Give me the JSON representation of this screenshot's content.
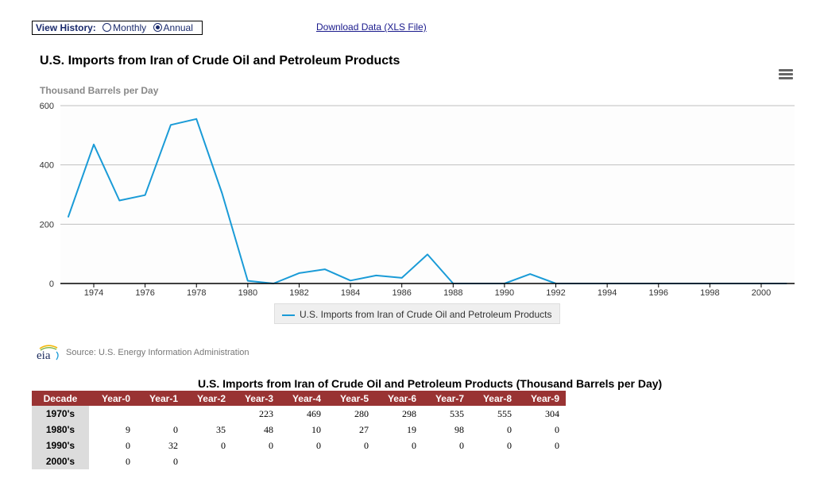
{
  "header": {
    "view_history_label": "View History:",
    "options": [
      {
        "label": "Monthly",
        "checked": false
      },
      {
        "label": "Annual",
        "checked": true
      }
    ],
    "download_link": "Download Data (XLS File)"
  },
  "menu_icon": "hamburger-menu-icon",
  "source": {
    "logo_text": "eia",
    "text": "Source: U.S. Energy Information Administration"
  },
  "chart_data": {
    "type": "line",
    "title": "U.S. Imports from Iran of Crude Oil and Petroleum Products",
    "ylabel": "Thousand Barrels per Day",
    "xlabel": "",
    "ylim": [
      0,
      600
    ],
    "xlim": [
      1972.7,
      2001.3
    ],
    "yticks": [
      "0",
      "200",
      "400",
      "600"
    ],
    "xticks": [
      "1974",
      "1976",
      "1978",
      "1980",
      "1982",
      "1984",
      "1986",
      "1988",
      "1990",
      "1992",
      "1994",
      "1996",
      "1998",
      "2000"
    ],
    "grid": true,
    "legend_position": "bottom-center",
    "color": "#1a9bd7",
    "series": [
      {
        "name": "U.S. Imports from Iran of Crude Oil and Petroleum Products",
        "x": [
          1973,
          1974,
          1975,
          1976,
          1977,
          1978,
          1979,
          1980,
          1981,
          1982,
          1983,
          1984,
          1985,
          1986,
          1987,
          1988,
          1989,
          1990,
          1991,
          1992,
          1993,
          1994,
          1995,
          1996,
          1997,
          1998,
          1999,
          2000,
          2001
        ],
        "values": [
          223,
          469,
          280,
          298,
          535,
          555,
          304,
          9,
          0,
          35,
          48,
          10,
          27,
          19,
          98,
          0,
          0,
          0,
          32,
          0,
          0,
          0,
          0,
          0,
          0,
          0,
          0,
          0,
          0
        ]
      }
    ]
  },
  "table": {
    "title": "U.S. Imports from Iran of Crude Oil and Petroleum Products (Thousand Barrels per Day)",
    "headers": [
      "Decade",
      "Year-0",
      "Year-1",
      "Year-2",
      "Year-3",
      "Year-4",
      "Year-5",
      "Year-6",
      "Year-7",
      "Year-8",
      "Year-9"
    ],
    "rows": [
      {
        "decade": "1970's",
        "values": [
          "",
          "",
          "",
          "223",
          "469",
          "280",
          "298",
          "535",
          "555",
          "304"
        ]
      },
      {
        "decade": "1980's",
        "values": [
          "9",
          "0",
          "35",
          "48",
          "10",
          "27",
          "19",
          "98",
          "0",
          "0"
        ]
      },
      {
        "decade": "1990's",
        "values": [
          "0",
          "32",
          "0",
          "0",
          "0",
          "0",
          "0",
          "0",
          "0",
          "0"
        ]
      },
      {
        "decade": "2000's",
        "values": [
          "0",
          "0",
          "",
          "",
          "",
          "",
          "",
          "",
          "",
          ""
        ]
      }
    ]
  }
}
